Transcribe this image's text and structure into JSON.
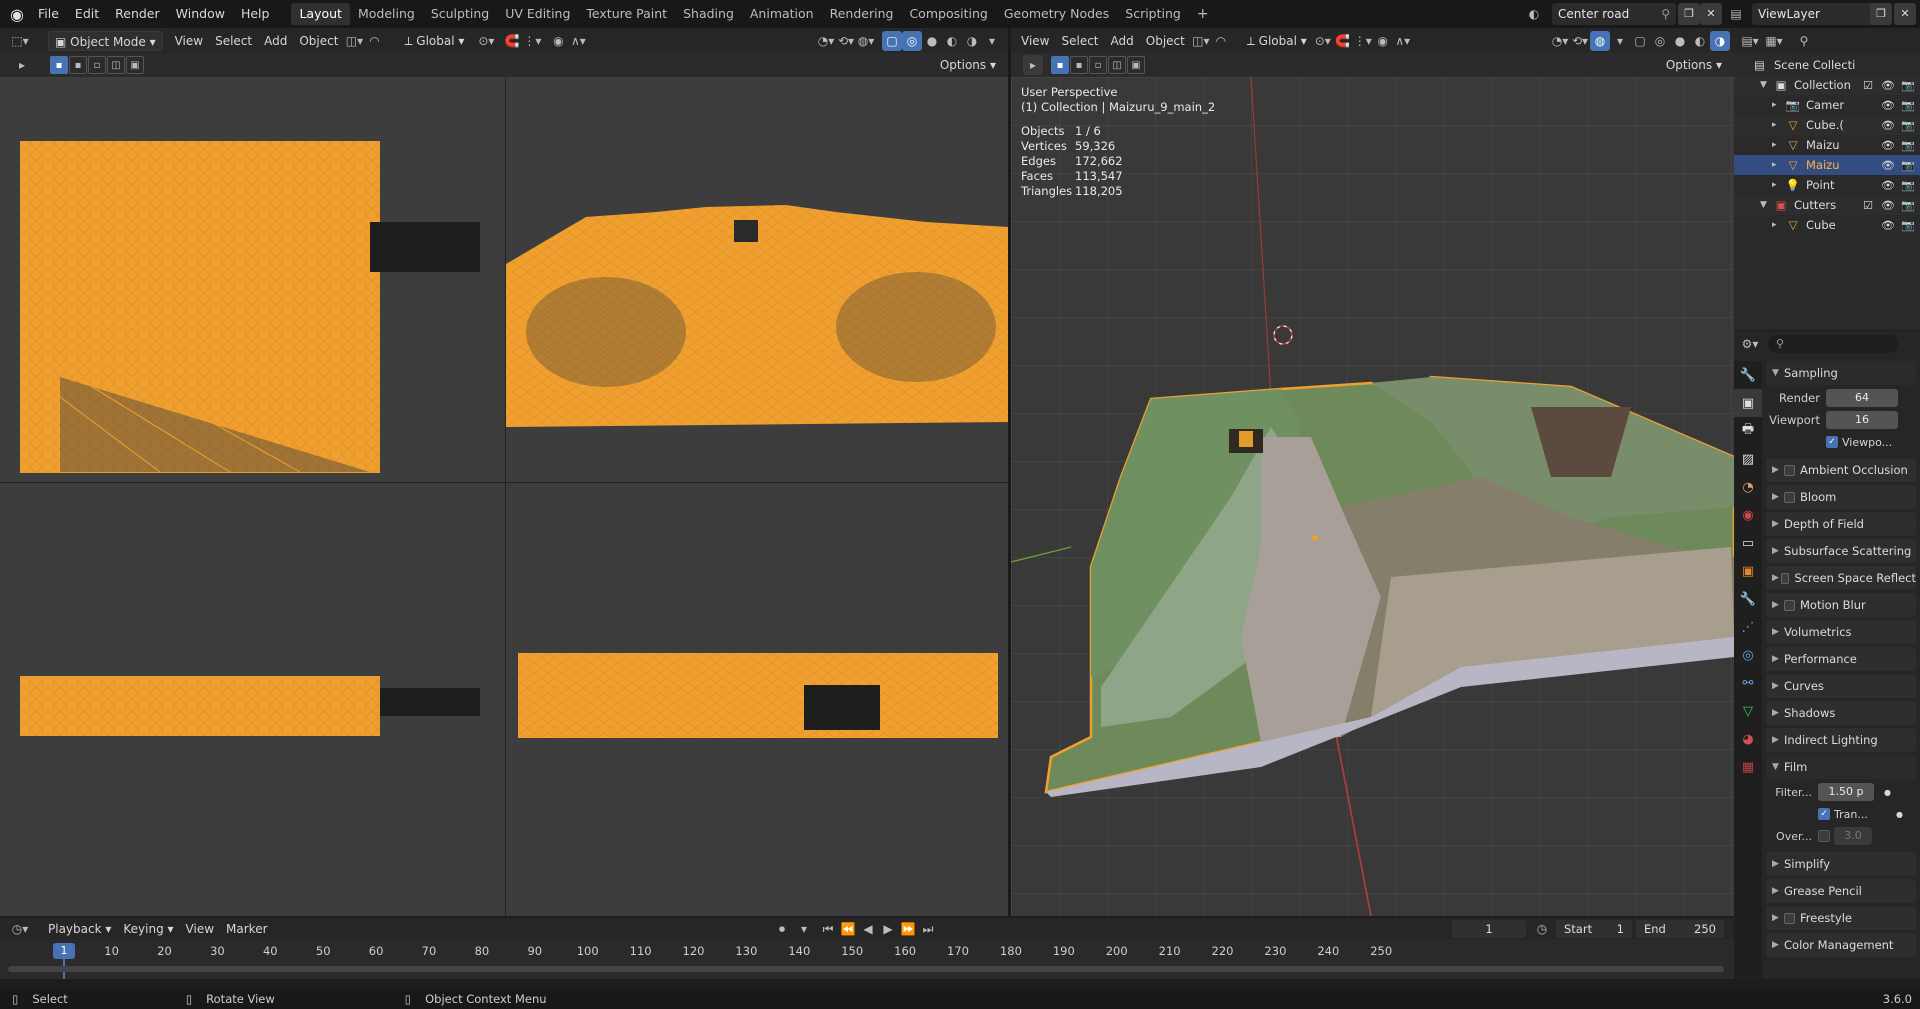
{
  "topbar": {
    "menus": [
      "File",
      "Edit",
      "Render",
      "Window",
      "Help"
    ],
    "workspaces": [
      "Layout",
      "Modeling",
      "Sculpting",
      "UV Editing",
      "Texture Paint",
      "Shading",
      "Animation",
      "Rendering",
      "Compositing",
      "Geometry Nodes",
      "Scripting"
    ],
    "active_workspace": "Layout",
    "scene_name": "Center road",
    "view_layer": "ViewLayer"
  },
  "left_view_header": {
    "mode": "Object Mode",
    "menus": [
      "View",
      "Select",
      "Add",
      "Object"
    ],
    "orientation": "Global",
    "options": "Options"
  },
  "right_view_header": {
    "menus": [
      "View",
      "Select",
      "Add",
      "Object"
    ],
    "orientation": "Global",
    "options": "Options"
  },
  "viewport_overlay": {
    "perspective": "User Perspective",
    "context": "(1) Collection | Maizuru_9_main_2",
    "stats": [
      {
        "label": "Objects",
        "value": "1 / 6"
      },
      {
        "label": "Vertices",
        "value": "59,326"
      },
      {
        "label": "Edges",
        "value": "172,662"
      },
      {
        "label": "Faces",
        "value": "113,547"
      },
      {
        "label": "Triangles",
        "value": "118,205"
      }
    ]
  },
  "outliner": {
    "root": "Scene Collecti",
    "items": [
      {
        "name": "Collection",
        "level": 1,
        "icon": "collection-icon",
        "color": "#e0e0e0"
      },
      {
        "name": "Camer",
        "level": 2,
        "icon": "camera-icon",
        "color": "#e8a04a"
      },
      {
        "name": "Cube.(",
        "level": 2,
        "icon": "mesh-icon",
        "color": "#e8a04a"
      },
      {
        "name": "Maizu",
        "level": 2,
        "icon": "mesh-icon",
        "color": "#e8a04a"
      },
      {
        "name": "Maizu",
        "level": 2,
        "icon": "mesh-icon",
        "color": "#e8a04a",
        "selected": true
      },
      {
        "name": "Point",
        "level": 2,
        "icon": "light-icon",
        "color": "#e8a04a"
      },
      {
        "name": "Cutters",
        "level": 1,
        "icon": "collection-icon",
        "color": "#e05050"
      },
      {
        "name": "Cube",
        "level": 2,
        "icon": "mesh-icon",
        "color": "#e8a04a"
      }
    ]
  },
  "properties": {
    "search_placeholder": "",
    "sampling": {
      "title": "Sampling",
      "render_label": "Render",
      "render_value": "64",
      "viewport_label": "Viewport",
      "viewport_value": "16",
      "viewport_denoise": "Viewpo..."
    },
    "panels": [
      "Ambient Occlusion",
      "Bloom",
      "Depth of Field",
      "Subsurface Scattering",
      "Screen Space Reflect",
      "Motion Blur",
      "Volumetrics",
      "Performance",
      "Curves",
      "Shadows",
      "Indirect Lighting"
    ],
    "panels_with_checkbox": [
      "Ambient Occlusion",
      "Bloom",
      "Screen Space Reflect",
      "Motion Blur"
    ],
    "film": {
      "title": "Film",
      "filter_label": "Filter...",
      "filter_value": "1.50 p",
      "transparent_label": "Tran...",
      "overscan_label": "Over...",
      "overscan_value": "3.0"
    },
    "panels_after": [
      "Simplify",
      "Grease Pencil",
      "Freestyle",
      "Color Management"
    ],
    "panels_after_checkbox": [
      "Freestyle"
    ]
  },
  "timeline": {
    "menus": [
      "Playback",
      "Keying",
      "View",
      "Marker"
    ],
    "current_frame": "1",
    "start_label": "Start",
    "start_value": "1",
    "end_label": "End",
    "end_value": "250",
    "ruler": [
      "1",
      "10",
      "20",
      "30",
      "40",
      "50",
      "60",
      "70",
      "80",
      "90",
      "100",
      "110",
      "120",
      "130",
      "140",
      "150",
      "160",
      "170",
      "180",
      "190",
      "200",
      "210",
      "220",
      "230",
      "240",
      "250"
    ]
  },
  "statusbar": {
    "select": "Select",
    "rotate": "Rotate View",
    "context_menu": "Object Context Menu",
    "version": "3.6.0"
  },
  "colors": {
    "accent": "#4772b3",
    "mesh_orange": "#f0a030",
    "selected_row": "#334d80"
  }
}
